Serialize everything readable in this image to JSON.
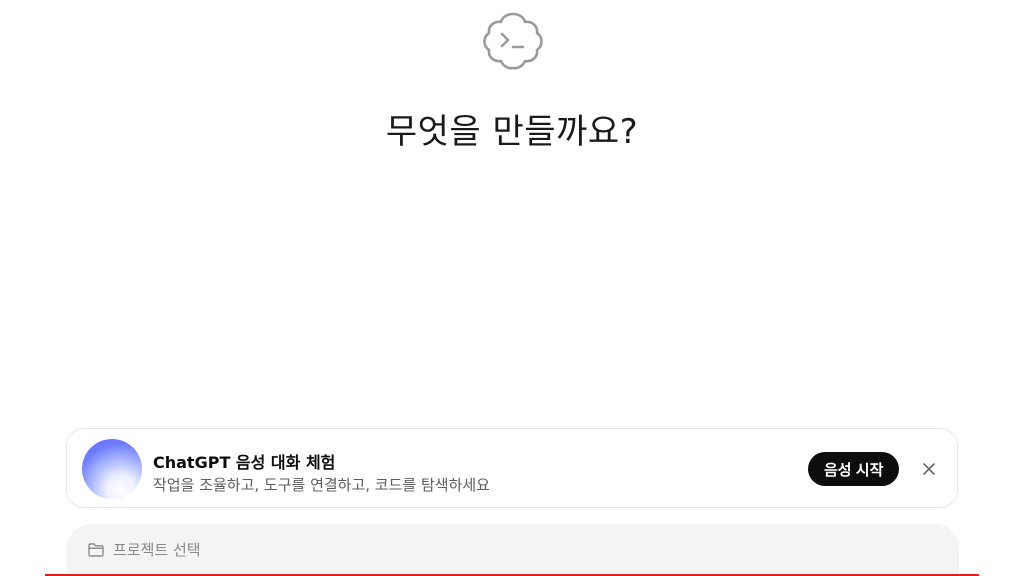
{
  "main": {
    "headline": "무엇을 만들까요?",
    "logo_icon": "codex-cloud-terminal-icon"
  },
  "voice_card": {
    "title": "ChatGPT 음성 대화 체험",
    "subtitle": "작업을 조율하고, 도구를 연결하고, 코드를 탐색하세요",
    "start_label": "음성 시작",
    "close_icon": "close-icon",
    "orb_icon": "voice-orb-icon"
  },
  "composer": {
    "project_label": "프로젝트 선택",
    "project_icon": "folder-icon"
  },
  "colors": {
    "accent_dark": "#0d0d0d",
    "composer_bg": "#f4f4f4",
    "orb_blue": "#6e7dff",
    "red_line": "#e02020"
  }
}
